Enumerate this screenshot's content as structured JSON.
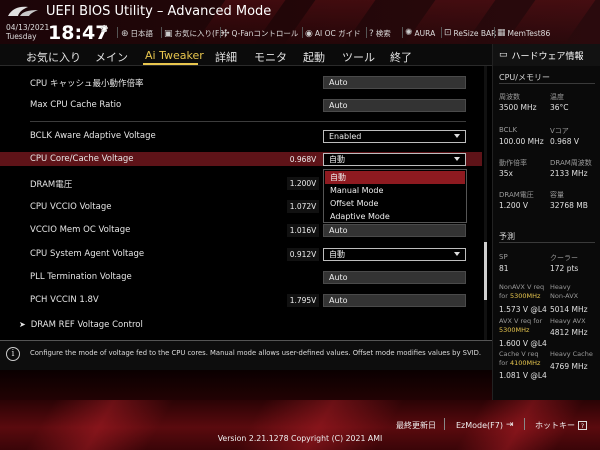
{
  "header": {
    "title": "UEFI BIOS Utility – Advanced Mode",
    "date": "04/13/2021",
    "weekday": "Tuesday",
    "time": "18:47",
    "items": [
      {
        "icon": "globe-icon",
        "label": "日本語"
      },
      {
        "icon": "favorites-icon",
        "label": "お気に入り(F3)"
      },
      {
        "icon": "fan-icon",
        "label": "Q-Fanコントロール"
      },
      {
        "icon": "ai-oc-icon",
        "label": "AI OC ガイド"
      },
      {
        "icon": "search-icon",
        "label": "検索"
      },
      {
        "icon": "aura-icon",
        "label": "AURA"
      },
      {
        "icon": "resize-bar-icon",
        "label": "ReSize BAR"
      },
      {
        "icon": "memtest-icon",
        "label": "MemTest86"
      }
    ]
  },
  "menu": {
    "tabs": [
      "お気に入り",
      "メイン",
      "Ai Tweaker",
      "詳細",
      "モニタ",
      "起動",
      "ツール",
      "終了"
    ],
    "active": "Ai Tweaker"
  },
  "settings": [
    {
      "label": "CPU キャッシュ最小動作倍率",
      "value": "Auto",
      "type": "input"
    },
    {
      "label": "Max CPU Cache Ratio",
      "value": "Auto",
      "type": "input"
    },
    {
      "label": "BCLK Aware Adaptive Voltage",
      "value": "Enabled",
      "type": "select"
    },
    {
      "label": "CPU Core/Cache Voltage",
      "voltage": "0.968V",
      "value": "自動",
      "type": "select"
    },
    {
      "label": "DRAM電圧",
      "voltage": "1.200V",
      "value": "",
      "type": "input"
    },
    {
      "label": "CPU VCCIO Voltage",
      "voltage": "1.072V",
      "value": "",
      "type": "input"
    },
    {
      "label": "VCCIO Mem OC Voltage",
      "voltage": "1.016V",
      "value": "Auto",
      "type": "input"
    },
    {
      "label": "CPU System Agent Voltage",
      "voltage": "0.912V",
      "value": "自動",
      "type": "select"
    },
    {
      "label": "PLL Termination Voltage",
      "value": "Auto",
      "type": "input"
    },
    {
      "label": "PCH VCCIN 1.8V",
      "voltage": "1.795V",
      "value": "Auto",
      "type": "input"
    },
    {
      "label": "DRAM REF Voltage Control",
      "type": "submenu"
    }
  ],
  "dropdown": {
    "options": [
      "自動",
      "Manual Mode",
      "Offset Mode",
      "Adaptive Mode"
    ],
    "selected": "自動"
  },
  "help": {
    "text": "Configure the mode of voltage fed to the CPU cores. Manual mode allows user-defined values. Offset mode modifies values by SVID."
  },
  "hw": {
    "title": "ハードウェア情報",
    "cpu_mem": {
      "title": "CPU/メモリー",
      "items": [
        {
          "label": "周波数",
          "value": "3500 MHz"
        },
        {
          "label": "温度",
          "value": "36°C"
        },
        {
          "label": "BCLK",
          "value": "100.00 MHz"
        },
        {
          "label": "Vコア",
          "value": "0.968 V"
        },
        {
          "label": "動作倍率",
          "value": "35x"
        },
        {
          "label": "DRAM周波数",
          "value": "2133 MHz"
        },
        {
          "label": "DRAM電圧",
          "value": "1.200 V"
        },
        {
          "label": "容量",
          "value": "32768 MB"
        }
      ]
    },
    "predict": {
      "title": "予測",
      "items": [
        {
          "label": "SP",
          "value": "81"
        },
        {
          "label": "クーラー",
          "value": "172 pts"
        }
      ],
      "nonavx_req_a": "NonAVX V req",
      "nonavx_req_b": "for",
      "nonavx_freq": "5300MHz",
      "nonavx_v": "1.573 V @L4",
      "heavy_nonavx_a": "Heavy",
      "heavy_nonavx_b": "Non-AVX",
      "heavy_nonavx_val": "5014 MHz",
      "avx_req": "AVX V req",
      "avx_for": "for",
      "avx_freq": "5300MHz",
      "avx_v": "1.600 V @L4",
      "heavy_avx": "Heavy AVX",
      "heavy_avx_val": "4812 MHz",
      "cache_req_a": "Cache V req",
      "cache_req_b": "for",
      "cache_freq": "4100MHz",
      "cache_v": "1.081 V @L4",
      "heavy_cache": "Heavy Cache",
      "heavy_cache_val": "4769 MHz"
    }
  },
  "footer": {
    "last_modified": "最終更新日",
    "ezmode": "EzMode(F7)",
    "hotkeys": "ホットキー",
    "version": "Version 2.21.1278 Copyright (C) 2021 AMI"
  },
  "colors": {
    "accent": "#e8c64e",
    "highlight_row": "#5e1318",
    "dropdown_selected": "#8e1a20"
  }
}
